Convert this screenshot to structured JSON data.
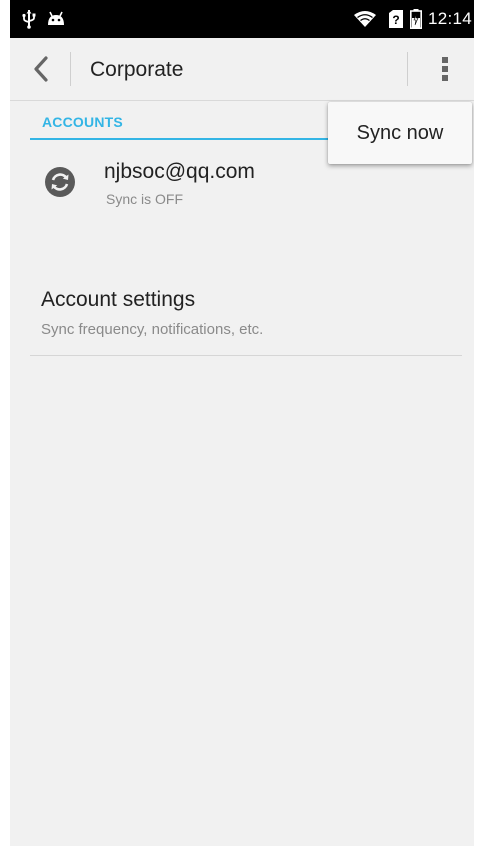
{
  "status_bar": {
    "time": "12:14",
    "icons": [
      "usb-icon",
      "android-debug-icon",
      "wifi-icon",
      "no-sim-icon",
      "battery-charging-icon"
    ]
  },
  "action_bar": {
    "title": "Corporate",
    "back_icon": "back-chevron-icon",
    "overflow_icon": "overflow-menu-icon"
  },
  "accounts_section": {
    "header": "ACCOUNTS",
    "accent_color": "#33b5e5",
    "account": {
      "email": "njbsoc@qq.com",
      "status": "Sync is OFF",
      "icon": "sync-icon"
    }
  },
  "account_settings": {
    "title": "Account settings",
    "subtitle": "Sync frequency, notifications, etc."
  },
  "popup_menu": {
    "items": [
      {
        "label": "Sync now"
      }
    ]
  }
}
